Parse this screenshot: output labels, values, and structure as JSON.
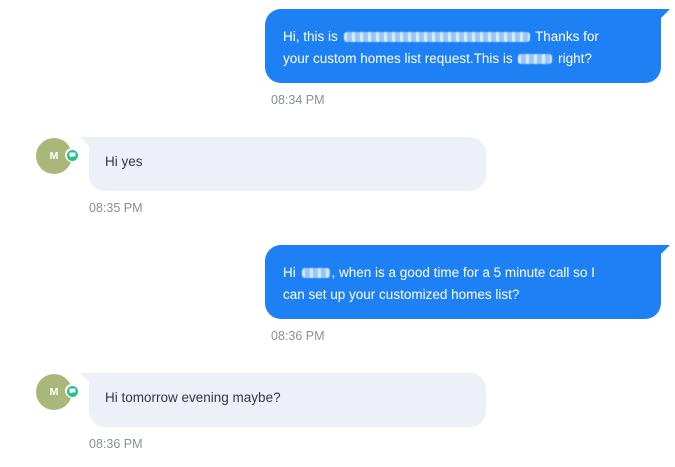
{
  "colors": {
    "outgoing_bubble": "#1e80f5",
    "incoming_bubble": "#eef0f8",
    "avatar_bg": "#a9b77a",
    "channel_badge": "#23c28a",
    "timestamp_text": "#8a909a"
  },
  "messages": [
    {
      "direction": "outgoing",
      "part1": "Hi, this is",
      "part2": "Thanks for",
      "part3": "your custom homes list request.This is",
      "part4": "right?",
      "time": "08:34 PM"
    },
    {
      "direction": "incoming",
      "avatar_initial": "M",
      "channel_icon": "sms-chat-icon",
      "text": "Hi yes",
      "time": "08:35 PM"
    },
    {
      "direction": "outgoing",
      "part1": "Hi",
      "part2": ", when is a good time for a 5 minute call so I",
      "part3": "can set up your customized homes list?",
      "time": "08:36 PM"
    },
    {
      "direction": "incoming",
      "avatar_initial": "M",
      "channel_icon": "sms-chat-icon",
      "text": "Hi tomorrow evening maybe?",
      "time": "08:36 PM"
    }
  ]
}
